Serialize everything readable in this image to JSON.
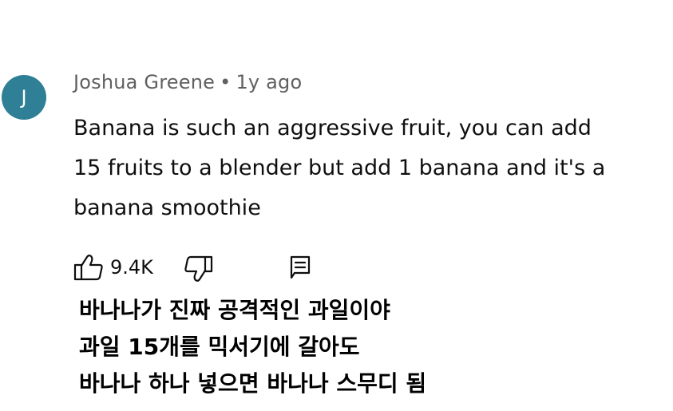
{
  "comment": {
    "avatar_letter": "J",
    "author": "Joshua Greene",
    "separator": "•",
    "timestamp": "1y ago",
    "text_lines": [
      "Banana is such an aggressive fruit, you can add",
      "15 fruits to a blender but add 1 banana and it's a",
      "banana smoothie"
    ],
    "like_count": "9.4K",
    "icons": {
      "like": "thumbs-up-icon",
      "dislike": "thumbs-down-icon",
      "reply": "comment-reply-icon"
    }
  },
  "caption": {
    "lines": [
      "바나나가 진짜 공격적인 과일이야",
      "과일 15개를 믹서기에 갈아도",
      "바나나 하나 넣으면 바나나 스무디 됨"
    ]
  },
  "colors": {
    "avatar_bg": "#2f7f96",
    "meta_text": "#606060",
    "body_text": "#0f0f0f",
    "caption_text": "#000000"
  }
}
